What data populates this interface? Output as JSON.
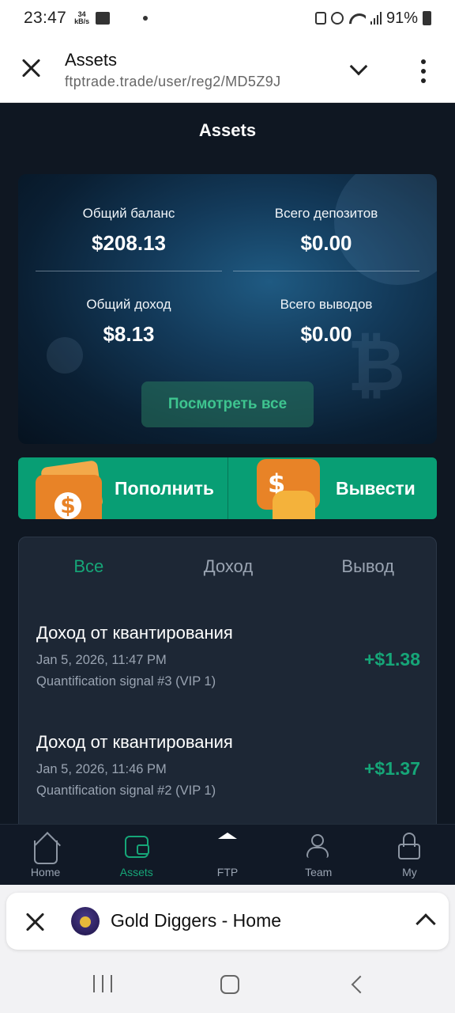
{
  "status": {
    "time": "23:47",
    "speed": "34",
    "speed_unit": "kB/s",
    "battery": "91%"
  },
  "browser": {
    "title": "Assets",
    "url": "ftptrade.trade/user/reg2/MD5Z9J"
  },
  "page": {
    "title": "Assets"
  },
  "balance": {
    "total_balance_label": "Общий баланс",
    "total_balance": "$208.13",
    "total_deposits_label": "Всего депозитов",
    "total_deposits": "$0.00",
    "total_income_label": "Общий доход",
    "total_income": "$8.13",
    "total_withdrawals_label": "Всего выводов",
    "total_withdrawals": "$0.00",
    "view_all_label": "Посмотреть все"
  },
  "actions": {
    "deposit_label": "Пополнить",
    "withdraw_label": "Вывести"
  },
  "tabs": [
    {
      "label": "Все",
      "active": true
    },
    {
      "label": "Доход",
      "active": false
    },
    {
      "label": "Вывод",
      "active": false
    }
  ],
  "transactions": [
    {
      "title": "Доход от квантирования",
      "date": "Jan 5, 2026, 11:47 PM",
      "desc": "Quantification signal #3 (VIP 1)",
      "amount": "+$1.38"
    },
    {
      "title": "Доход от квантирования",
      "date": "Jan 5, 2026, 11:46 PM",
      "desc": "Quantification signal #2 (VIP 1)",
      "amount": "+$1.37"
    }
  ],
  "bottom_nav": [
    {
      "label": "Home",
      "icon": "home-icon"
    },
    {
      "label": "Assets",
      "icon": "wallet-icon",
      "active": true
    },
    {
      "label": "FTP",
      "icon": "ftp-icon"
    },
    {
      "label": "Team",
      "icon": "team-icon"
    },
    {
      "label": "My",
      "icon": "user-icon"
    }
  ],
  "custom_tab": {
    "title": "Gold Diggers - Home"
  },
  "colors": {
    "accent": "#16a678",
    "background": "#0f1722",
    "panel": "#1d2735"
  }
}
